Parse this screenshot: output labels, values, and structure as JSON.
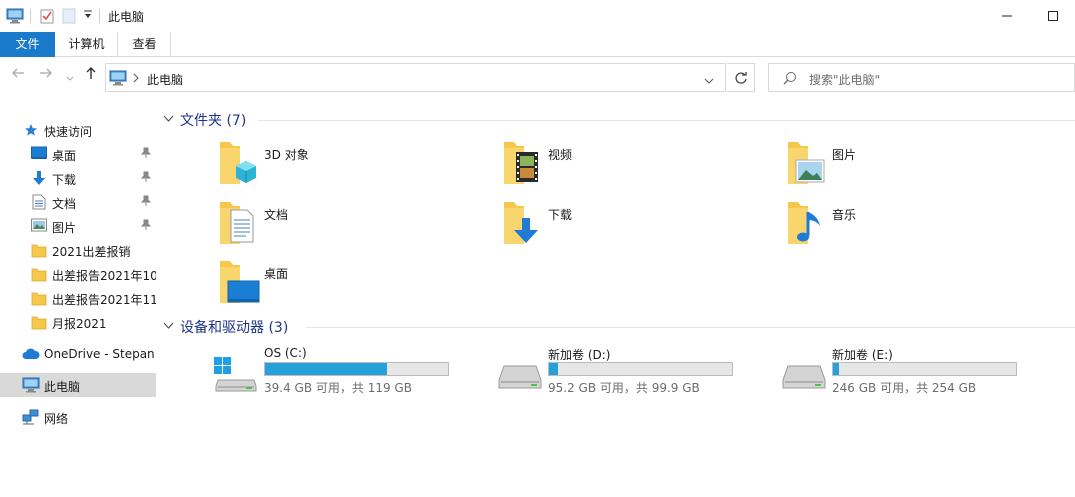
{
  "window": {
    "title": "此电脑"
  },
  "ribbon": {
    "tabs": [
      "文件",
      "计算机",
      "查看"
    ]
  },
  "address": {
    "path": "此电脑"
  },
  "search": {
    "placeholder": "搜索\"此电脑\""
  },
  "nav": {
    "quick_access": "快速访问",
    "items": [
      {
        "label": "桌面",
        "pinned": true,
        "icon": "desktop-icon"
      },
      {
        "label": "下载",
        "pinned": true,
        "icon": "download-icon"
      },
      {
        "label": "文档",
        "pinned": true,
        "icon": "document-icon"
      },
      {
        "label": "图片",
        "pinned": true,
        "icon": "picture-icon"
      },
      {
        "label": "2021出差报销",
        "pinned": false,
        "icon": "folder-icon"
      },
      {
        "label": "出差报告2021年10",
        "pinned": false,
        "icon": "folder-icon"
      },
      {
        "label": "出差报告2021年11",
        "pinned": false,
        "icon": "folder-icon"
      },
      {
        "label": "月报2021",
        "pinned": false,
        "icon": "folder-icon"
      }
    ],
    "onedrive": "OneDrive - Stepan",
    "this_pc": "此电脑",
    "network": "网络"
  },
  "content": {
    "folders_header": "文件夹 (7)",
    "folders": [
      {
        "label": "3D 对象",
        "icon": "3d-objects-folder-icon"
      },
      {
        "label": "视频",
        "icon": "videos-folder-icon"
      },
      {
        "label": "图片",
        "icon": "pictures-folder-icon"
      },
      {
        "label": "文档",
        "icon": "documents-folder-icon"
      },
      {
        "label": "下载",
        "icon": "downloads-folder-icon"
      },
      {
        "label": "音乐",
        "icon": "music-folder-icon"
      },
      {
        "label": "桌面",
        "icon": "desktop-folder-icon"
      }
    ],
    "devices_header": "设备和驱动器 (3)",
    "drives": [
      {
        "name": "OS (C:)",
        "free": "39.4 GB 可用，共 119 GB",
        "used_fraction": 0.669,
        "icon": "windows-drive-icon"
      },
      {
        "name": "新加卷 (D:)",
        "free": "95.2 GB 可用，共 99.9 GB",
        "used_fraction": 0.047,
        "icon": "hard-drive-icon"
      },
      {
        "name": "新加卷 (E:)",
        "free": "246 GB 可用，共 254 GB",
        "used_fraction": 0.031,
        "icon": "hard-drive-icon"
      }
    ]
  },
  "colors": {
    "accent": "#1979ca",
    "header_text": "#1e3287",
    "drive_fill": "#26a0da",
    "folder_yellow": "#f5c84c"
  }
}
